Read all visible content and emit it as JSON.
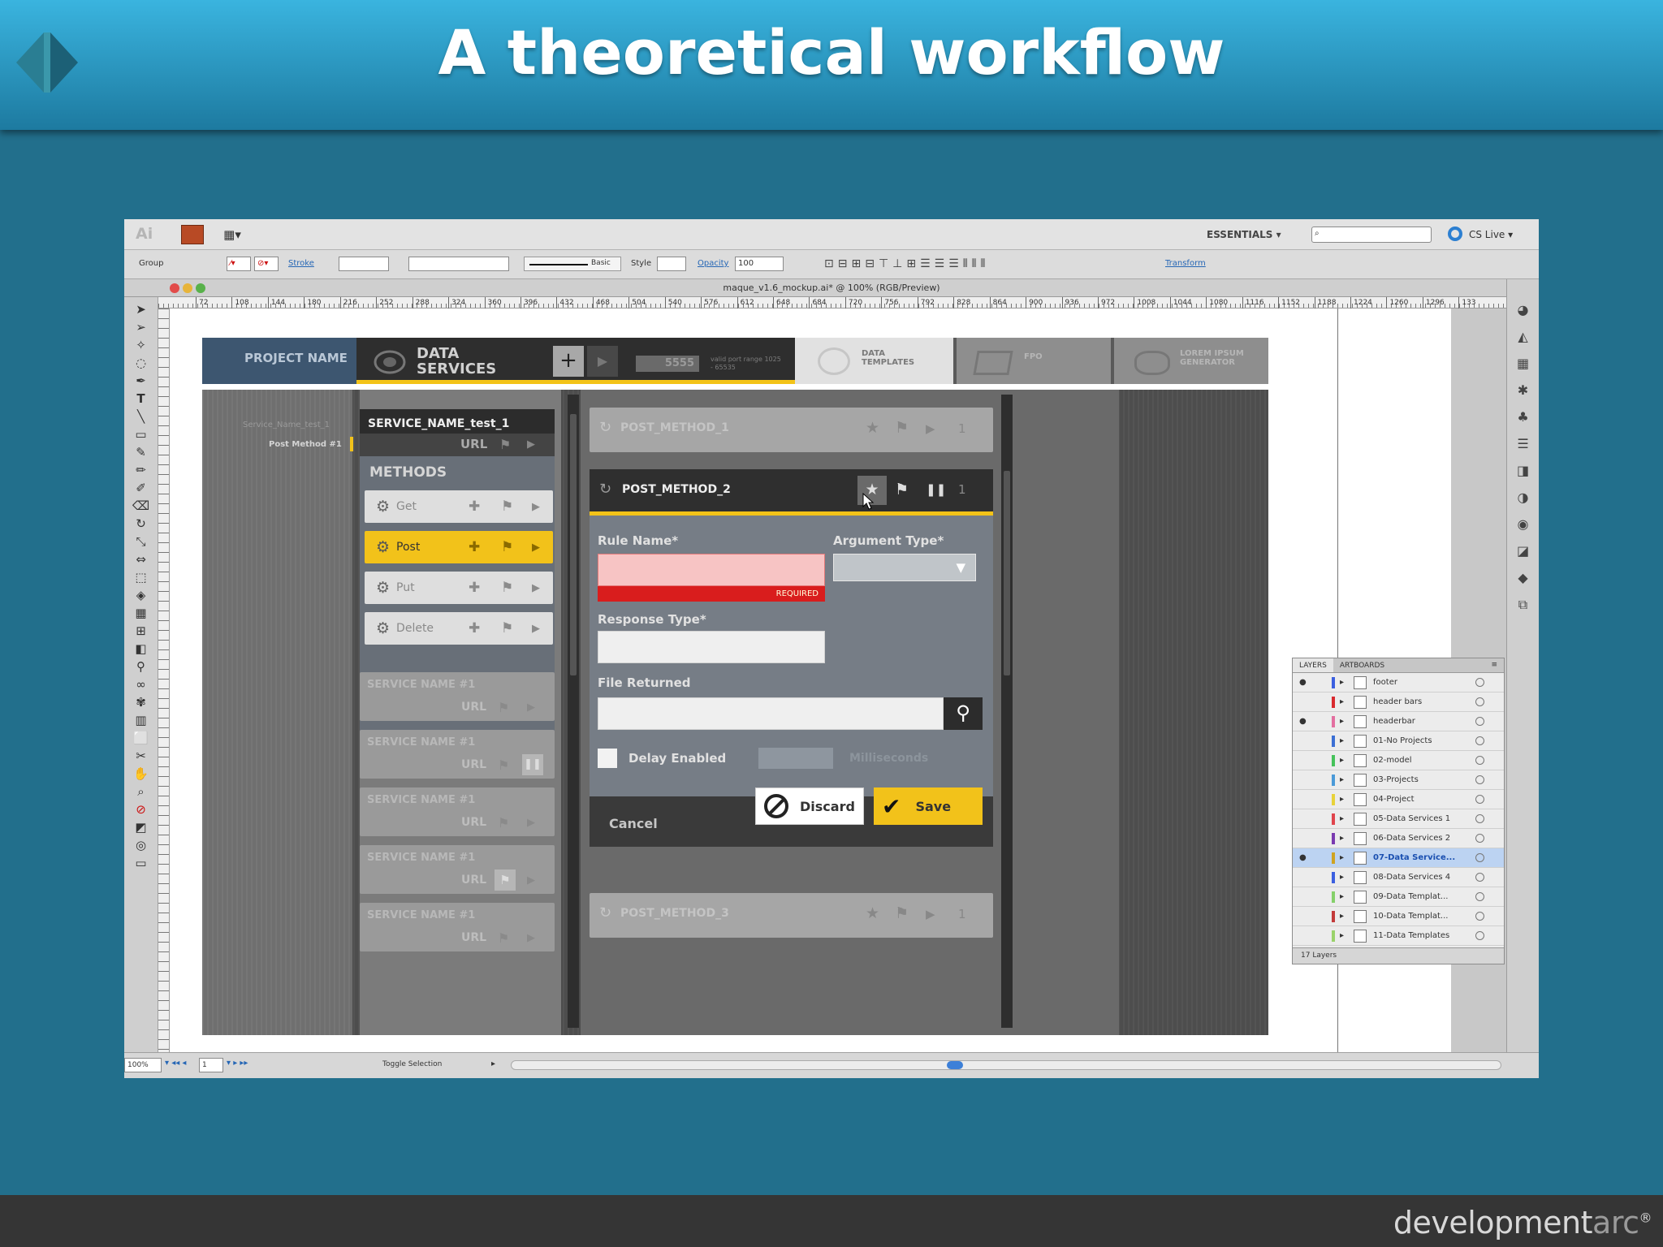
{
  "slide": {
    "title": "A theoretical workflow",
    "footer_brand_bold": "development",
    "footer_brand_thin": "arc",
    "footer_brand_mark": "®"
  },
  "app": {
    "logo_text": "Ai",
    "workspace": "ESSENTIALS",
    "cs_live": "CS Live",
    "control_bar": {
      "selection": "Group",
      "stroke_label": "Stroke",
      "stroke_style": "Basic",
      "style_label": "Style",
      "opacity_label": "Opacity",
      "opacity_value": "100",
      "transform_link": "Transform"
    },
    "document_title": "maque_v1.6_mockup.ai* @ 100% (RGB/Preview)",
    "ruler_ticks": [
      "72",
      "108",
      "144",
      "180",
      "216",
      "252",
      "288",
      "324",
      "360",
      "396",
      "432",
      "468",
      "504",
      "540",
      "576",
      "612",
      "648",
      "684",
      "720",
      "756",
      "792",
      "828",
      "864",
      "900",
      "936",
      "972",
      "1008",
      "1044",
      "1080",
      "1116",
      "1152",
      "1188",
      "1224",
      "1260",
      "1296",
      "133"
    ],
    "status": {
      "zoom": "100%",
      "artboard": "1",
      "toggle_label": "Toggle Selection"
    },
    "layers_panel": {
      "tabs": [
        "LAYERS",
        "ARTBOARDS"
      ],
      "layers": [
        {
          "name": "footer",
          "color": "#3b5fe0"
        },
        {
          "name": "header bars",
          "color": "#d9292e"
        },
        {
          "name": "headerbar",
          "color": "#e36fa0"
        },
        {
          "name": "01-No Projects",
          "color": "#3b6fd4"
        },
        {
          "name": "02-model",
          "color": "#45c25a"
        },
        {
          "name": "03-Projects",
          "color": "#4a9ad8"
        },
        {
          "name": "04-Project",
          "color": "#e8d23a"
        },
        {
          "name": "05-Data Services 1",
          "color": "#e0444c"
        },
        {
          "name": "06-Data Services 2",
          "color": "#7a3ab0"
        },
        {
          "name": "07-Data Service...",
          "color": "#cfa322"
        },
        {
          "name": "08-Data Services 4",
          "color": "#3b5fe0"
        },
        {
          "name": "09-Data Templat...",
          "color": "#85d06a"
        },
        {
          "name": "10-Data Templat...",
          "color": "#c33a3a"
        },
        {
          "name": "11-Data Templates",
          "color": "#9ad26a"
        }
      ],
      "footer_count": "17 Layers"
    }
  },
  "mockup": {
    "project_name": "PROJECT NAME",
    "data_services_line1": "DATA",
    "data_services_line2": "SERVICES",
    "port_value": "5555",
    "port_hint": "valid port range 1025 - 65535",
    "tabs": [
      {
        "line1": "DATA",
        "line2": "TEMPLATES"
      },
      {
        "line1": "FPO",
        "line2": ""
      },
      {
        "line1": "LOREM IPSUM",
        "line2": "GENERATOR"
      }
    ],
    "breadcrumb_service": "Service_Name_test_1",
    "breadcrumb_method": "Post Method #1",
    "active_service": "SERVICE_NAME_test_1",
    "url_label": "URL",
    "methods_heading": "METHODS",
    "methods": [
      "Get",
      "Post",
      "Put",
      "Delete"
    ],
    "services": [
      "SERVICE NAME #1",
      "SERVICE NAME #1",
      "SERVICE NAME #1",
      "SERVICE NAME #1",
      "SERVICE NAME #1"
    ],
    "post_methods": {
      "first": "POST_METHOD_1",
      "active": "POST_METHOD_2",
      "last": "POST_METHOD_3",
      "count": "1"
    },
    "form": {
      "rule_name_label": "Rule Name*",
      "required_label": "REQUIRED",
      "argument_type_label": "Argument Type*",
      "response_type_label": "Response Type*",
      "file_returned_label": "File Returned",
      "delay_label": "Delay Enabled",
      "milliseconds_placeholder": "Milliseconds",
      "cancel": "Cancel",
      "discard": "Discard",
      "save": "Save"
    }
  }
}
